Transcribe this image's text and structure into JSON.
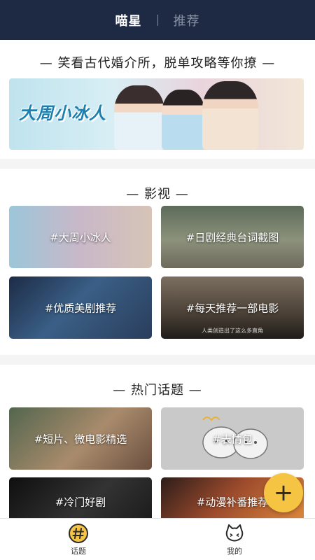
{
  "header": {
    "tabs": [
      {
        "label": "喵星",
        "active": true
      },
      {
        "label": "推荐",
        "active": false
      }
    ]
  },
  "banner_section": {
    "title": "— 笑看古代婚介所，脱单攻略等你撩 —",
    "banner_title": "大周小冰人"
  },
  "film_section": {
    "title": "— 影视 —",
    "cards": [
      {
        "label": "#大周小冰人"
      },
      {
        "label": "#日剧经典台词截图"
      },
      {
        "label": "#优质美剧推荐"
      },
      {
        "label": "#每天推荐一部电影",
        "subtitle": "人类创造出了这么多直角"
      }
    ]
  },
  "hot_section": {
    "title": "— 热门话题 —",
    "cards": [
      {
        "label": "#短片、微电影精选"
      },
      {
        "label": "#表情包"
      },
      {
        "label": "#冷门好剧"
      },
      {
        "label": "#动漫补番推荐"
      }
    ]
  },
  "fab": {
    "icon": "plus-icon"
  },
  "bottom_nav": {
    "items": [
      {
        "label": "话题",
        "icon": "hashtag-icon",
        "active": true
      },
      {
        "label": "我的",
        "icon": "cat-face-icon",
        "active": false
      }
    ]
  },
  "colors": {
    "header_bg": "#1e2a44",
    "accent_yellow": "#f6c443"
  }
}
